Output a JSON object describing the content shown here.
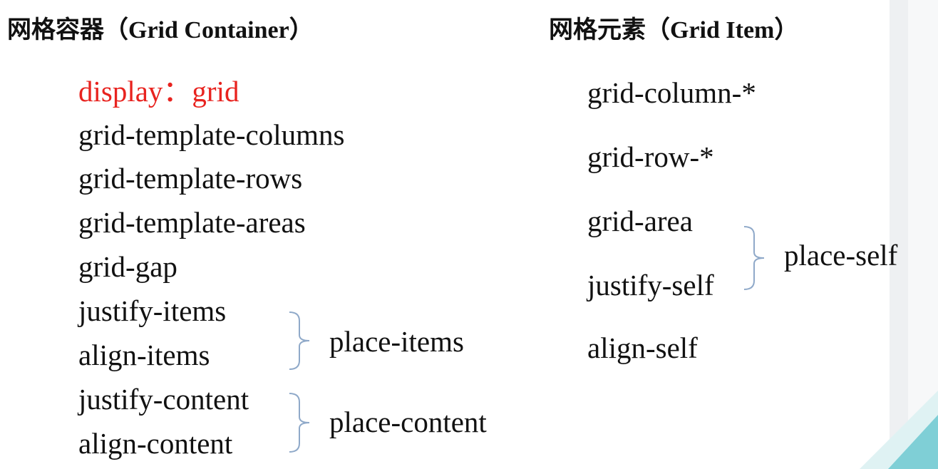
{
  "container": {
    "heading": "网格容器（Grid Container）",
    "items": [
      "display：grid",
      "grid-template-columns",
      "grid-template-rows",
      "grid-template-areas",
      "grid-gap",
      "justify-items",
      "align-items",
      "justify-content",
      "align-content"
    ],
    "groups": [
      {
        "label": "place-items"
      },
      {
        "label": "place-content"
      }
    ]
  },
  "item": {
    "heading": "网格元素（Grid Item）",
    "items": [
      "grid-column-*",
      "grid-row-*",
      "grid-area",
      "justify-self",
      "align-self"
    ],
    "groups": [
      {
        "label": "place-self"
      }
    ]
  },
  "colors": {
    "highlight": "#e8231f",
    "text": "#111111",
    "brace": "#8fa9c9",
    "accent": "#7fcfd6"
  }
}
